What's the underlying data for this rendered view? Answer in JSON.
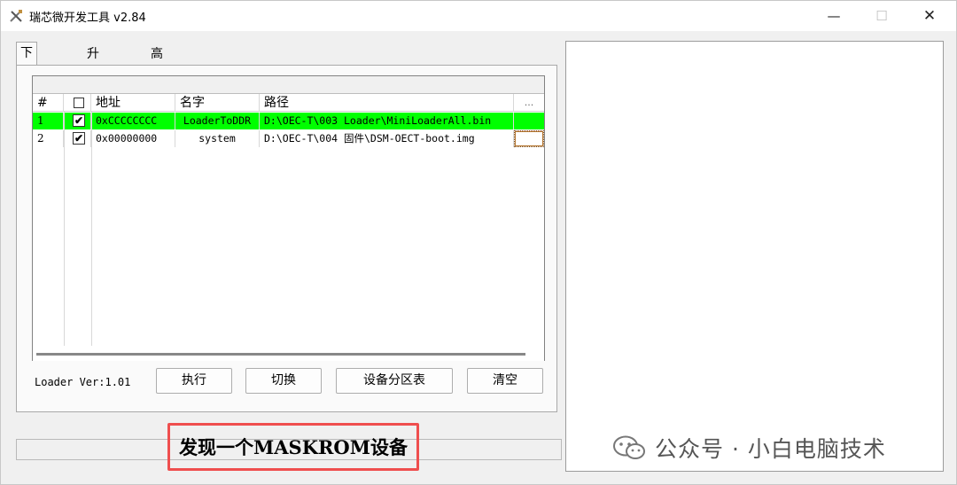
{
  "window": {
    "title": "瑞芯微开发工具 v2.84",
    "icon": "tools-icon",
    "controls": {
      "minimize": "—",
      "maximize": "☐",
      "close": "✕"
    }
  },
  "tabs": [
    {
      "label": "下载镜像",
      "active": true
    },
    {
      "label": "升级固件",
      "active": false
    },
    {
      "label": "高级功能",
      "active": false
    }
  ],
  "table": {
    "headers": {
      "num": "#",
      "check": "",
      "address": "地址",
      "name": "名字",
      "path": "路径",
      "more": "..."
    },
    "rows": [
      {
        "num": "1",
        "checked": "✔",
        "address": "0xCCCCCCCC",
        "name": "LoaderToDDR",
        "path": "D:\\OEC-T\\003 Loader\\MiniLoaderAll.bin",
        "highlight": true
      },
      {
        "num": "2",
        "checked": "✔",
        "address": "0x00000000",
        "name": "system",
        "path": "D:\\OEC-T\\004 固件\\DSM-OECT-boot.img",
        "highlight": false
      }
    ]
  },
  "loader_version": "Loader Ver:1.01",
  "buttons": {
    "execute": "执行",
    "switch": "切换",
    "partition_table": "设备分区表",
    "clear": "清空"
  },
  "status": {
    "message": "发现一个MASKROM设备",
    "highlight_color": "#ef4e4e"
  },
  "watermark": {
    "text": "公众号 · 小白电脑技术",
    "icon": "wechat-icon"
  },
  "colors": {
    "row_highlight": "#00ff00",
    "window_bg": "#f0f0f0"
  }
}
